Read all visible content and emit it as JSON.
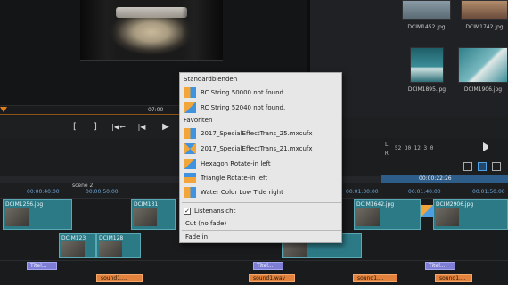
{
  "ruler": {
    "time": "07:00"
  },
  "bin": {
    "thumbs": [
      {
        "label": "DCIM1452.jpg",
        "color": "#6b7f8f"
      },
      {
        "label": "DCIM1742.jpg",
        "color": "#7a5a48"
      },
      {
        "label": "DCIM1895.jpg",
        "color": "#2e6f78"
      },
      {
        "label": "DCIM1906.jpg",
        "color": "#6fa9b4"
      }
    ]
  },
  "transport": {
    "mark_in": "[",
    "mark_out": "]",
    "to_start": "|◀←",
    "prev": "|◀",
    "play": "▶"
  },
  "tc_panel": {
    "l_label": "L",
    "r_label": "R",
    "values": "52 30 12 3 0"
  },
  "timeline": {
    "scene": "scene 2",
    "times": [
      "00:00:40:00",
      "00:00:50:00",
      "00:01:30:00",
      "00:01:40:00",
      "00:01:50:00"
    ],
    "current": "00:00:22:26"
  },
  "clips": {
    "video": [
      {
        "label": "DCIM1256.jpg"
      },
      {
        "label": "DCIM131"
      },
      {
        "label": "DCIM1642.jpg"
      },
      {
        "label": "DCIM2906.jpg"
      }
    ],
    "overlay": [
      {
        "label": "DCIM123"
      },
      {
        "label": "DCIM128"
      }
    ]
  },
  "titles": [
    "Titel...",
    "Titel...",
    "Titel..."
  ],
  "sounds": [
    "sound1....",
    "sound1.wav",
    "sound1....",
    "sound1...."
  ],
  "menu": {
    "header_standard": "Standardblenden",
    "standard": [
      {
        "label": "RC String 50000 not found.",
        "icon": "transition-icon"
      },
      {
        "label": "RC String 52040 not found.",
        "icon": "transition-icon"
      }
    ],
    "header_favorites": "Favoriten",
    "favorites": [
      {
        "label": "2017_SpecialEffectTrans_25.mxcufx",
        "icon": "transition-icon"
      },
      {
        "label": "2017_SpecialEffectTrans_21.mxcufx",
        "icon": "transition-icon"
      },
      {
        "label": "Hexagon Rotate-in left",
        "icon": "transition-icon"
      },
      {
        "label": "Triangle Rotate-in left",
        "icon": "transition-icon"
      },
      {
        "label": "Water Color Low Tide right",
        "icon": "transition-icon"
      }
    ],
    "list_view": "Listenansicht",
    "list_view_check": "✓",
    "cut": "Cut (no fade)",
    "fade_in": "Fade in"
  }
}
